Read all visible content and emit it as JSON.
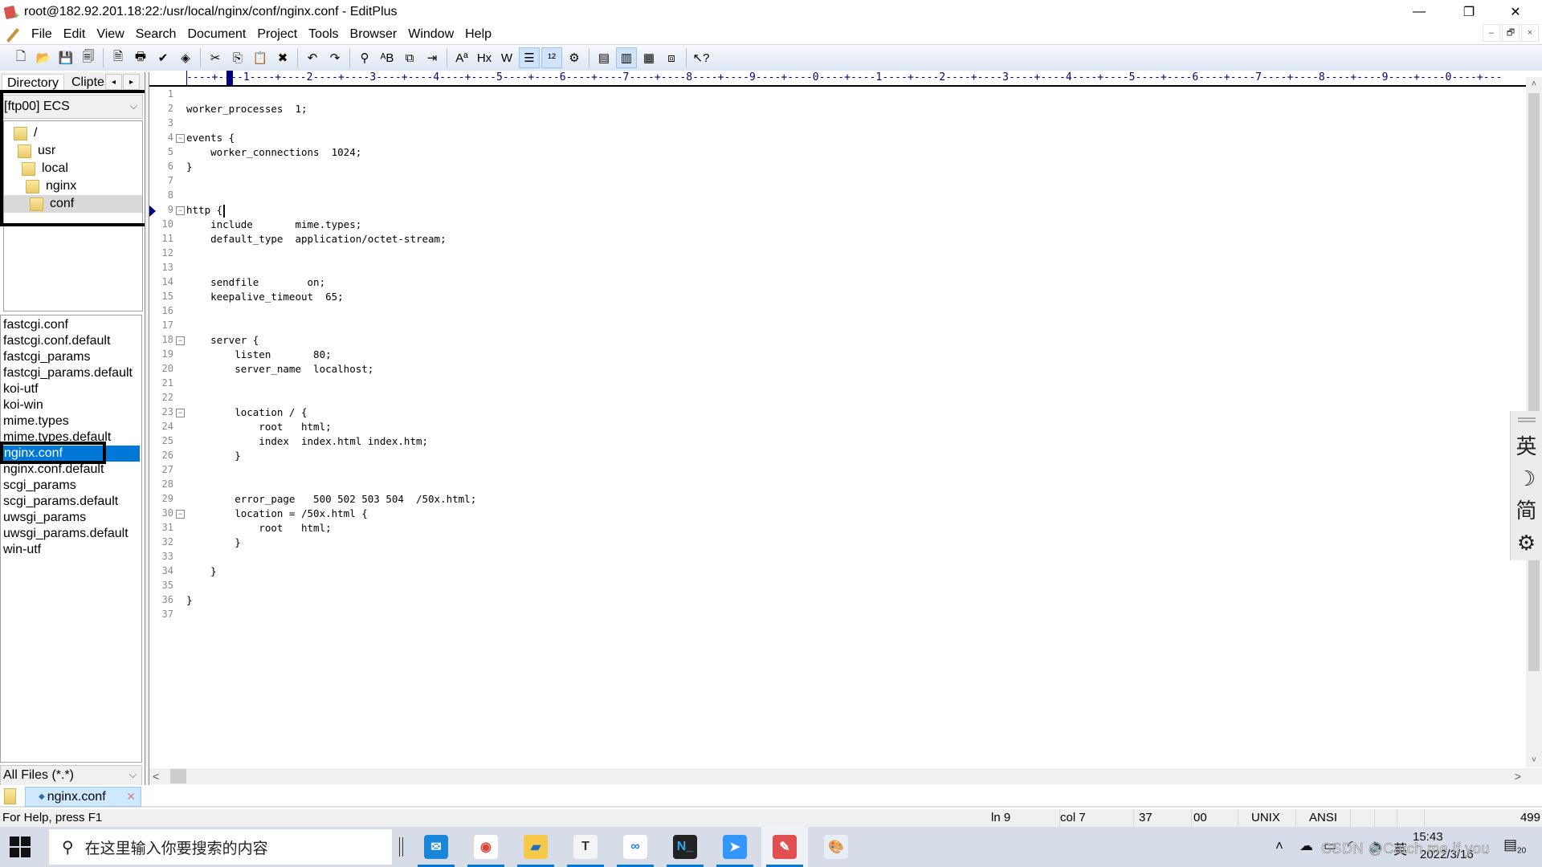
{
  "window": {
    "title": "root@182.92.201.18:22:/usr/local/nginx/conf/nginx.conf - EditPlus",
    "controls": {
      "minimize": "—",
      "restore": "❐",
      "close": "✕"
    },
    "mdi_controls": {
      "minimize": "–",
      "restore": "🗗",
      "close": "×"
    }
  },
  "menu": {
    "items": [
      "File",
      "Edit",
      "View",
      "Search",
      "Document",
      "Project",
      "Tools",
      "Browser",
      "Window",
      "Help"
    ]
  },
  "toolbar": {
    "buttons": [
      {
        "name": "new-file",
        "glyph": "🗋"
      },
      {
        "name": "open-file",
        "glyph": "📂"
      },
      {
        "name": "save",
        "glyph": "💾"
      },
      {
        "name": "save-all",
        "glyph": "🗐"
      },
      {
        "sep": true
      },
      {
        "name": "print-preview",
        "glyph": "🗎"
      },
      {
        "name": "print",
        "glyph": "🖶"
      },
      {
        "name": "spell-check",
        "glyph": "✔"
      },
      {
        "name": "view-in-browser",
        "glyph": "◈"
      },
      {
        "sep": true
      },
      {
        "name": "cut",
        "glyph": "✂"
      },
      {
        "name": "copy",
        "glyph": "⎘"
      },
      {
        "name": "paste",
        "glyph": "📋"
      },
      {
        "name": "delete",
        "glyph": "✖"
      },
      {
        "sep": true
      },
      {
        "name": "undo",
        "glyph": "↶"
      },
      {
        "name": "redo",
        "glyph": "↷"
      },
      {
        "sep": true
      },
      {
        "name": "find",
        "glyph": "⚲"
      },
      {
        "name": "replace",
        "glyph": "ᴬB"
      },
      {
        "name": "find-in-files",
        "glyph": "⧉"
      },
      {
        "name": "goto-line",
        "glyph": "⇥"
      },
      {
        "sep": true
      },
      {
        "name": "font",
        "glyph": "Aª"
      },
      {
        "name": "hex-viewer",
        "glyph": "Hx"
      },
      {
        "name": "word-wrap",
        "glyph": "W"
      },
      {
        "name": "line-numbers",
        "glyph": "☰",
        "active": true
      },
      {
        "name": "ruler",
        "glyph": "¹²",
        "active": true
      },
      {
        "name": "preferences",
        "glyph": "⚙"
      },
      {
        "sep": true
      },
      {
        "name": "directory-window",
        "glyph": "▤"
      },
      {
        "name": "output-window",
        "glyph": "▥",
        "active": true
      },
      {
        "name": "cliptext-window",
        "glyph": "▦"
      },
      {
        "name": "user-tools",
        "glyph": "⧈"
      },
      {
        "sep": true
      },
      {
        "name": "help-pointer",
        "glyph": "↖?"
      }
    ]
  },
  "left_panel": {
    "tabs": [
      "Directory",
      "Clipte"
    ],
    "tab_arrows": {
      "left": "◂",
      "right": "▸"
    },
    "drive": "[ftp00] ECS",
    "tree": [
      {
        "label": "/",
        "depth": 0
      },
      {
        "label": "usr",
        "depth": 1
      },
      {
        "label": "local",
        "depth": 2
      },
      {
        "label": "nginx",
        "depth": 3
      },
      {
        "label": "conf",
        "depth": 4,
        "selected": true
      }
    ],
    "files": [
      "fastcgi.conf",
      "fastcgi.conf.default",
      "fastcgi_params",
      "fastcgi_params.default",
      "koi-utf",
      "koi-win",
      "mime.types",
      "mime.types.default",
      "nginx.conf",
      "nginx.conf.default",
      "scgi_params",
      "scgi_params.default",
      "uwsgi_params",
      "uwsgi_params.default",
      "win-utf"
    ],
    "selected_file": "nginx.conf",
    "filter": "All Files (*.*)"
  },
  "ruler": {
    "text": "----+----1----+----2----+----3----+----4----+----5----+----6----+----7----+----8----+----9----+----0----+----1----+----2----+----3----+----4----+----5----+----6----+----7----+----8----+----9----+----0----+---"
  },
  "editor": {
    "current_line": 9,
    "lines": [
      {
        "n": 1,
        "text": ""
      },
      {
        "n": 2,
        "text": "worker_processes  1;"
      },
      {
        "n": 3,
        "text": ""
      },
      {
        "n": 4,
        "text": "events {",
        "fold": true
      },
      {
        "n": 5,
        "text": "    worker_connections  1024;"
      },
      {
        "n": 6,
        "text": "}"
      },
      {
        "n": 7,
        "text": ""
      },
      {
        "n": 8,
        "text": ""
      },
      {
        "n": 9,
        "text": "http {",
        "fold": true
      },
      {
        "n": 10,
        "text": "    include       mime.types;"
      },
      {
        "n": 11,
        "text": "    default_type  application/octet-stream;"
      },
      {
        "n": 12,
        "text": ""
      },
      {
        "n": 13,
        "text": ""
      },
      {
        "n": 14,
        "text": "    sendfile        on;"
      },
      {
        "n": 15,
        "text": "    keepalive_timeout  65;"
      },
      {
        "n": 16,
        "text": ""
      },
      {
        "n": 17,
        "text": ""
      },
      {
        "n": 18,
        "text": "    server {",
        "fold": true
      },
      {
        "n": 19,
        "text": "        listen       80;"
      },
      {
        "n": 20,
        "text": "        server_name  localhost;"
      },
      {
        "n": 21,
        "text": ""
      },
      {
        "n": 22,
        "text": ""
      },
      {
        "n": 23,
        "text": "        location / {",
        "fold": true
      },
      {
        "n": 24,
        "text": "            root   html;"
      },
      {
        "n": 25,
        "text": "            index  index.html index.htm;"
      },
      {
        "n": 26,
        "text": "        }"
      },
      {
        "n": 27,
        "text": ""
      },
      {
        "n": 28,
        "text": ""
      },
      {
        "n": 29,
        "text": "        error_page   500 502 503 504  /50x.html;"
      },
      {
        "n": 30,
        "text": "        location = /50x.html {",
        "fold": true
      },
      {
        "n": 31,
        "text": "            root   html;"
      },
      {
        "n": 32,
        "text": "        }"
      },
      {
        "n": 33,
        "text": ""
      },
      {
        "n": 34,
        "text": "    }"
      },
      {
        "n": 35,
        "text": ""
      },
      {
        "n": 36,
        "text": "}"
      },
      {
        "n": 37,
        "text": ""
      }
    ]
  },
  "ime_bar": {
    "items": [
      "英",
      "☽",
      "简",
      "⚙"
    ]
  },
  "scrollbars": {
    "up": "˄",
    "down": "˅",
    "left": "<",
    "right": ">"
  },
  "doc_tabs": [
    {
      "label": "nginx.conf",
      "close": "✕"
    }
  ],
  "status": {
    "help": "For Help, press F1",
    "line": "ln 9",
    "col": "col 7",
    "total_lines": "37",
    "hex": "00",
    "line_ending": "UNIX",
    "encoding": "ANSI",
    "file_size": "499"
  },
  "taskbar": {
    "search_placeholder": "在这里输入你要搜索的内容",
    "apps": [
      {
        "name": "mail",
        "glyph": "✉",
        "bg": "#1a86d9",
        "fg": "#ffffff"
      },
      {
        "name": "chrome",
        "glyph": "◉",
        "bg": "#ffffff",
        "fg": "#db4437"
      },
      {
        "name": "file-explorer",
        "glyph": "▰",
        "bg": "#f7c948",
        "fg": "#1a6fc4"
      },
      {
        "name": "typora",
        "glyph": "T",
        "bg": "#f4f4f4",
        "fg": "#333333"
      },
      {
        "name": "baidu-netdisk",
        "glyph": "∞",
        "bg": "#ffffff",
        "fg": "#2b7ce9"
      },
      {
        "name": "terminal",
        "glyph": "N_",
        "bg": "#222222",
        "fg": "#2ea8f5"
      },
      {
        "name": "dingtalk",
        "glyph": "➤",
        "bg": "#3296fa",
        "fg": "#ffffff"
      },
      {
        "name": "editplus",
        "glyph": "✎",
        "bg": "#e05050",
        "fg": "#ffffff",
        "active": true
      },
      {
        "name": "paint",
        "glyph": "🎨",
        "bg": "#e8eef6",
        "fg": "#b0762a"
      }
    ],
    "tray": {
      "chevron": "˄",
      "ime": "英",
      "time": "15:43",
      "date": "2022/3/16",
      "notification_count": "20"
    },
    "watermark": "CSDN @Catch me if you"
  }
}
